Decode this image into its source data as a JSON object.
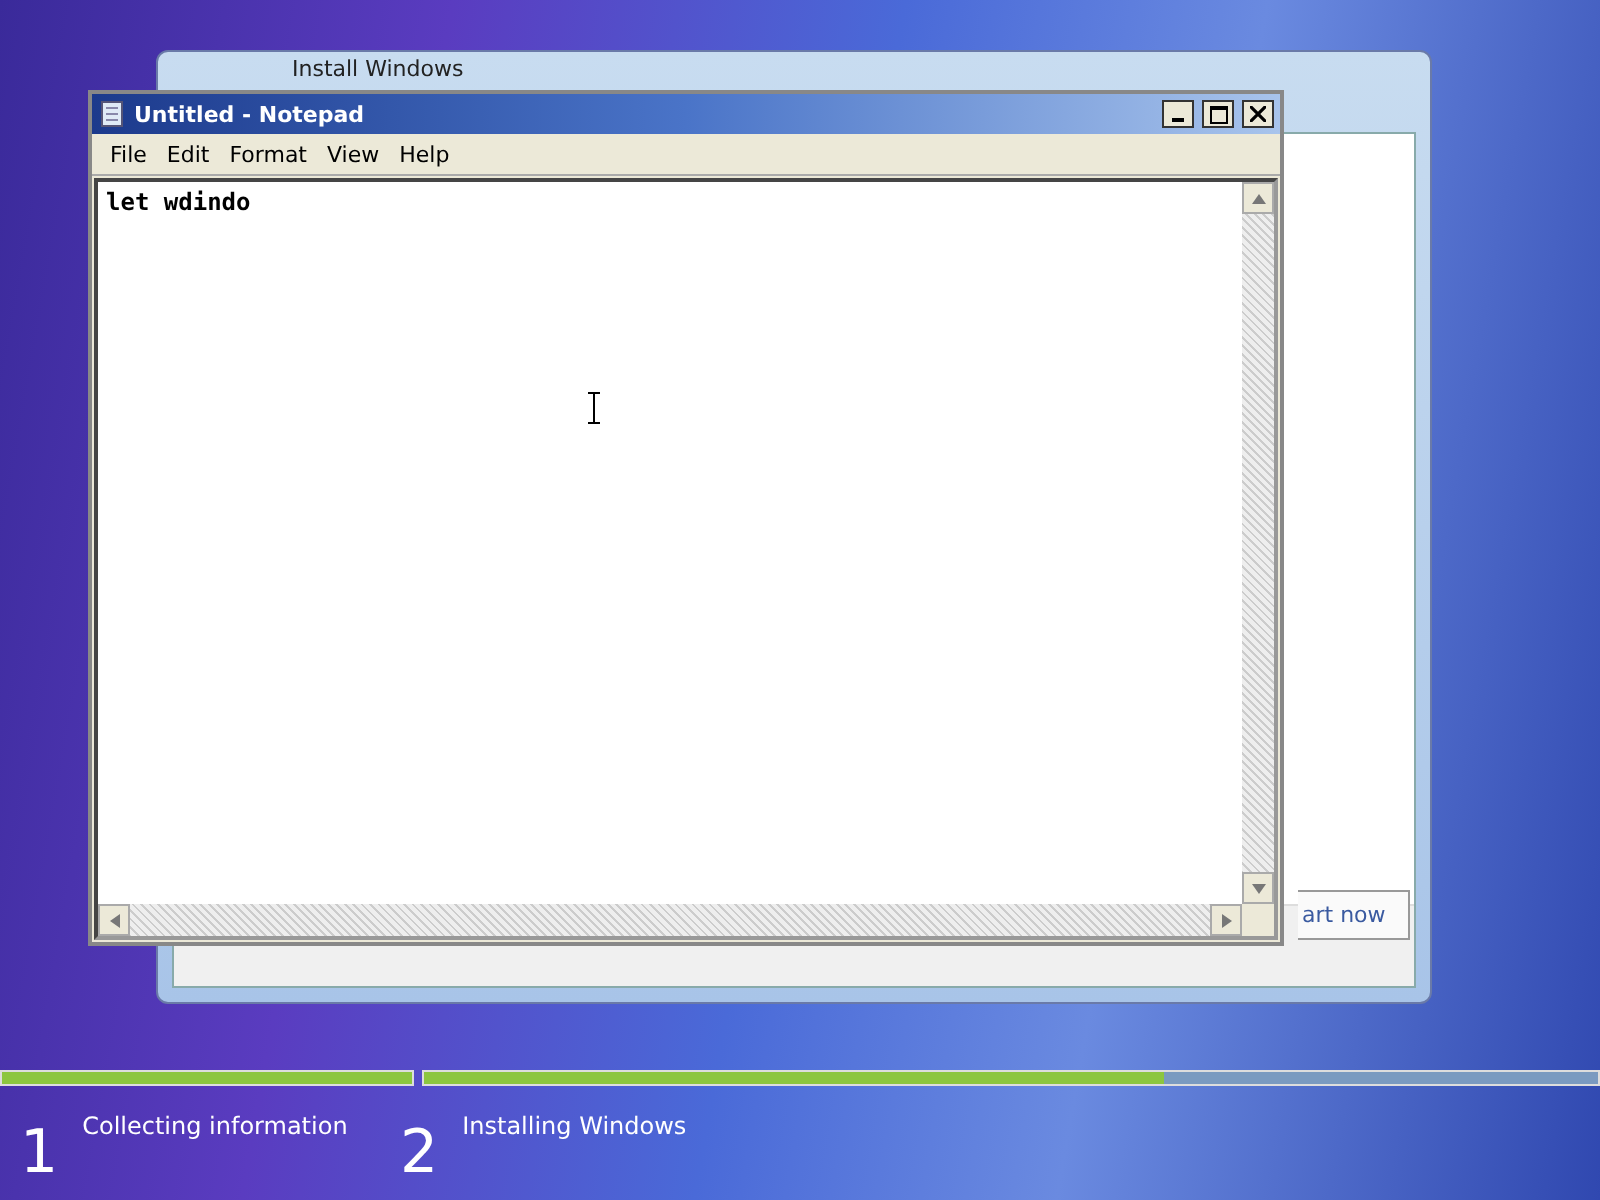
{
  "background_window": {
    "title": "Install Windows",
    "button": "art now"
  },
  "notepad": {
    "title": "Untitled - Notepad",
    "menu": [
      "File",
      "Edit",
      "Format",
      "View",
      "Help"
    ],
    "text": "let wdindo"
  },
  "progress": [
    {
      "level": 1
    },
    {
      "level": 0.63
    }
  ],
  "steps": [
    {
      "number": "1",
      "label": "Collecting information"
    },
    {
      "number": "2",
      "label": "Installing Windows"
    }
  ]
}
